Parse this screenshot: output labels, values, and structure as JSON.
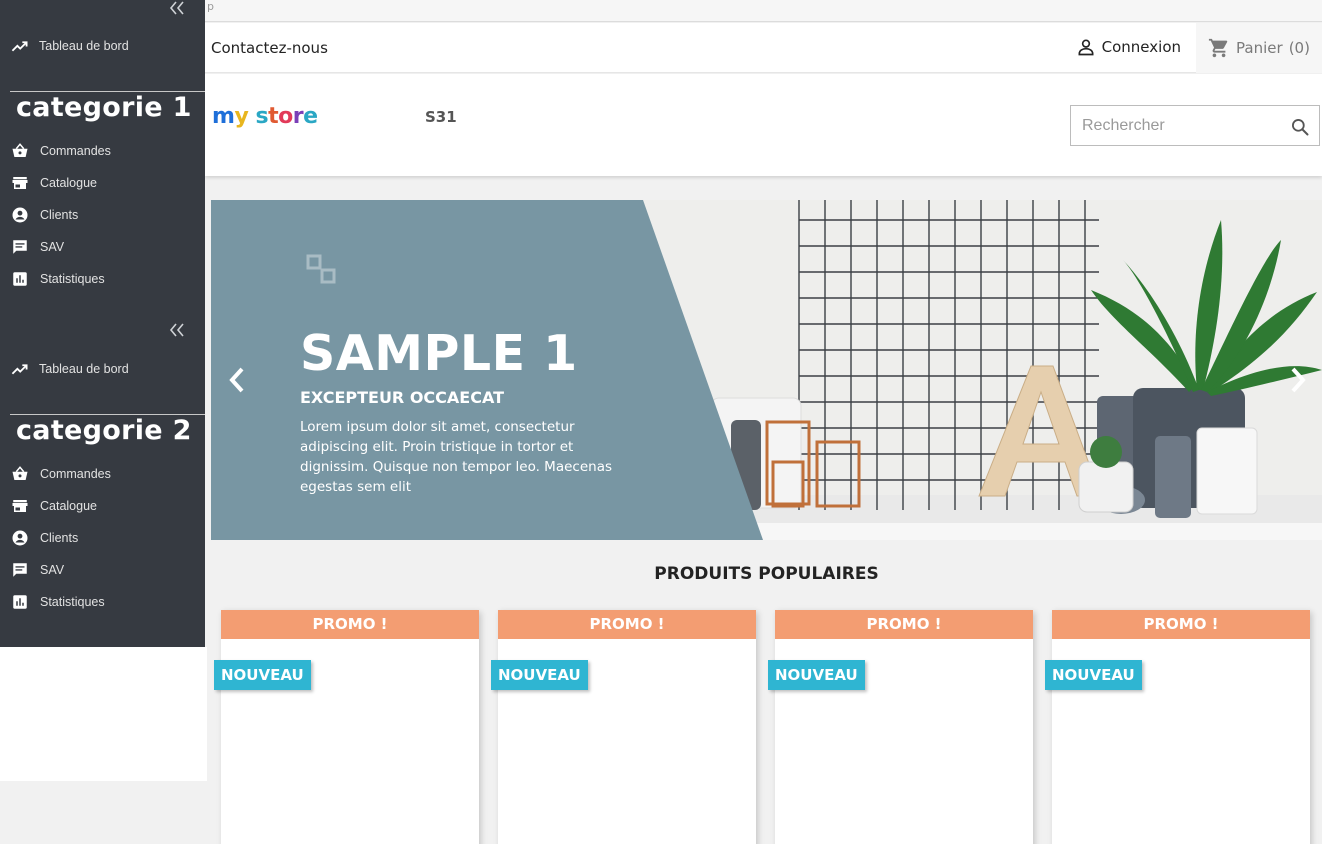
{
  "top_strip": {
    "text": "p"
  },
  "nav": {
    "contact_label": "Contactez-nous",
    "login_label": "Connexion",
    "cart_label": "Panier",
    "cart_count": "(0)"
  },
  "header": {
    "logo_text": "my store",
    "store_code": "S31",
    "search_placeholder": "Rechercher"
  },
  "slider": {
    "title": "SAMPLE 1",
    "subtitle": "EXCEPTEUR OCCAECAT",
    "text": "Lorem ipsum dolor sit amet, consectetur adipiscing elit. Proin tristique in tortor et dignissim. Quisque non tempor leo. Maecenas egestas sem elit",
    "caption_color": "#7896a3"
  },
  "products": {
    "section_title": "PRODUITS POPULAIRES",
    "items": [
      {
        "promo": "PROMO !",
        "badge": "NOUVEAU"
      },
      {
        "promo": "PROMO !",
        "badge": "NOUVEAU"
      },
      {
        "promo": "PROMO !",
        "badge": "NOUVEAU"
      },
      {
        "promo": "PROMO !",
        "badge": "NOUVEAU"
      }
    ]
  },
  "sidebar": {
    "collapse_label": "«",
    "group1": {
      "dashboard": "Tableau de bord",
      "category": "categorie 1",
      "items": [
        "Commandes",
        "Catalogue",
        "Clients",
        "SAV",
        "Statistiques"
      ]
    },
    "group2": {
      "dashboard": "Tableau de bord",
      "category": "categorie 2",
      "items": [
        "Commandes",
        "Catalogue",
        "Clients",
        "SAV",
        "Statistiques"
      ]
    }
  },
  "colors": {
    "sidebar_bg": "#363a41",
    "promo": "#f39d72",
    "nouveau": "#2fb5d2"
  }
}
